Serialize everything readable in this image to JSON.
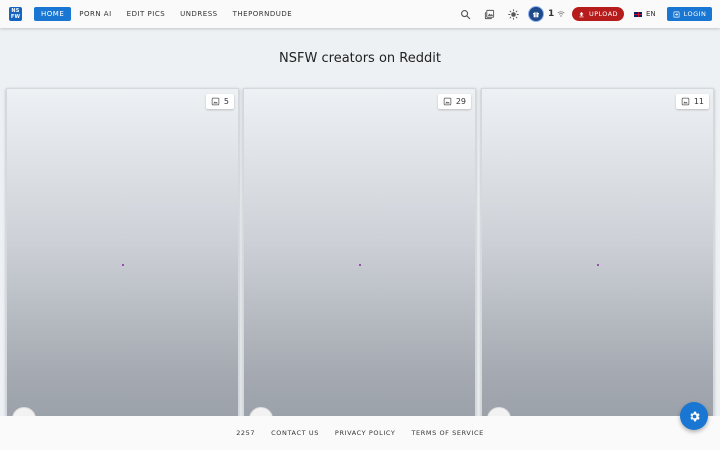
{
  "header": {
    "logo_top": "NS",
    "logo_bottom": "FW",
    "nav": [
      {
        "label": "HOME",
        "active": true
      },
      {
        "label": "PORN AI",
        "active": false
      },
      {
        "label": "EDIT PICS",
        "active": false
      },
      {
        "label": "UNDRESS",
        "active": false
      },
      {
        "label": "THEPORNDUDE",
        "active": false
      }
    ],
    "icons": [
      "search-icon",
      "gallery-icon",
      "brightness-icon"
    ],
    "gift_count": "1",
    "upload_label": "UPLOAD",
    "language": "EN",
    "login_label": "LOGIN"
  },
  "main": {
    "title": "NSFW creators on Reddit",
    "cards": [
      {
        "count": "5"
      },
      {
        "count": "29"
      },
      {
        "count": "11"
      }
    ]
  },
  "footer": {
    "links": [
      "2257",
      "CONTACT US",
      "PRIVACY POLICY",
      "TERMS OF SERVICE"
    ]
  },
  "fab": {
    "icon": "gear-icon"
  },
  "colors": {
    "primary": "#1976d2",
    "upload": "#b71c1c",
    "gift": "#1e4a8c",
    "background": "#edf1f4"
  }
}
